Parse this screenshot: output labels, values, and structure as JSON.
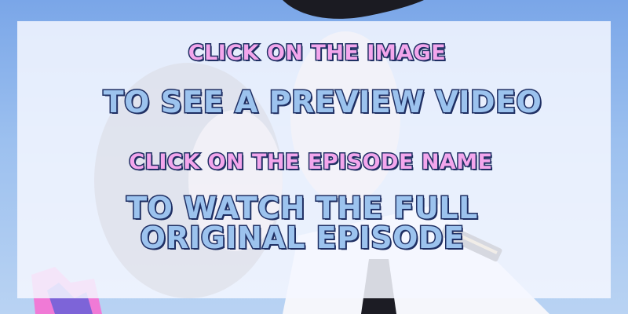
{
  "overlay": {
    "line1": "CLICK ON THE IMAGE",
    "line2": "TO SEE A PREVIEW VIDEO",
    "line3": "CLICK ON THE EPISODE NAME",
    "line4a": "TO WATCH THE FULL",
    "line4b": "ORIGINAL EPISODE"
  },
  "colors": {
    "pink_text": "#f3a6ec",
    "blue_text": "#9cc3ee",
    "outline": "#1f2f63",
    "background_sky": "#8fb3e6"
  }
}
